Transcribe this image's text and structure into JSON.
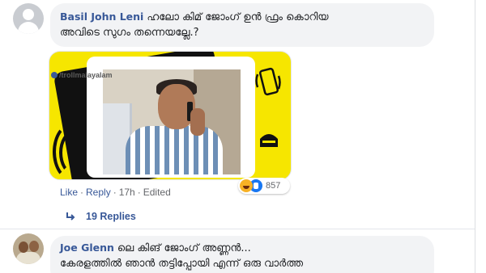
{
  "comments": [
    {
      "author": "Basil John Leni",
      "text_line1": "ഹലോ കിമ് ജോംഗ് ഉൻ ഫ്രം കൊറിയ",
      "text_line2": "അവിടെ സുഗം തന്നെയല്ലേ.?",
      "photo": {
        "watermark": "/trollmalayalam"
      },
      "reactions": {
        "icons": [
          "haha-reaction-icon",
          "like-reaction-icon"
        ],
        "count": "857"
      },
      "actions": {
        "like": "Like",
        "reply": "Reply",
        "time": "17h",
        "edited": "Edited",
        "separator": "·"
      },
      "replies_label": "19 Replies"
    },
    {
      "author": "Joe Glenn",
      "text_line1": "ലെ കിങ് ജോംഗ് അണ്ണൻ...",
      "text_line2": "കേരളത്തിൽ ഞാൻ തട്ടിപ്പോയി എന്ന് ഒരു വാർത്ത"
    }
  ],
  "colors": {
    "link": "#385898",
    "bubble": "#f2f3f5",
    "meta": "#65676b",
    "meme_yellow": "#f6e600"
  }
}
